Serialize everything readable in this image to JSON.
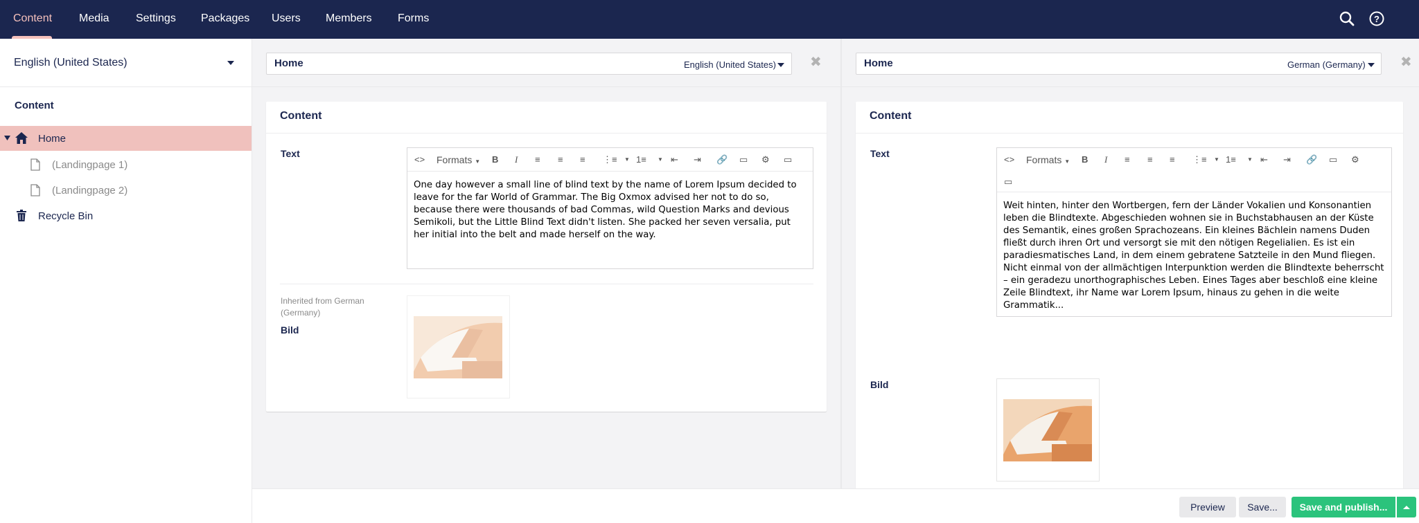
{
  "topnav": {
    "items": [
      {
        "label": "Content"
      },
      {
        "label": "Media"
      },
      {
        "label": "Settings"
      },
      {
        "label": "Packages"
      },
      {
        "label": "Users"
      },
      {
        "label": "Members"
      },
      {
        "label": "Forms"
      }
    ],
    "active": "Content"
  },
  "sidebar": {
    "language": "English (United States)",
    "section_title": "Content",
    "tree": [
      {
        "label": "Home",
        "icon": "home-icon",
        "selected": true
      },
      {
        "label": "(Landingpage 1)",
        "icon": "document-icon"
      },
      {
        "label": "(Landingpage 2)",
        "icon": "document-icon"
      },
      {
        "label": "Recycle Bin",
        "icon": "trash-icon"
      }
    ]
  },
  "left_editor": {
    "name": "Home",
    "language": "English (United States)",
    "card_title": "Content",
    "text_label": "Text",
    "text_content": "One day however a small line of blind text by the name of Lorem Ipsum decided to leave for the far World of Grammar. The Big Oxmox advised her not to do so, because there were thousands of bad Commas, wild Question Marks and devious Semikoli, but the Little Blind Text didn't listen. She packed her seven versalia, put her initial into the belt and made herself on the way.",
    "inherited_note": "Inherited from German (Germany)",
    "image_label": "Bild"
  },
  "right_editor": {
    "name": "Home",
    "language": "German (Germany)",
    "card_title": "Content",
    "text_label": "Text",
    "text_content": "Weit hinten, hinter den Wortbergen, fern der Länder Vokalien und Konsonantien leben die Blindtexte. Abgeschieden wohnen sie in Buchstabhausen an der Küste des Semantik, eines großen Sprachozeans. Ein kleines Bächlein namens Duden fließt durch ihren Ort und versorgt sie mit den nötigen Regelialien. Es ist ein paradiesmatisches Land, in dem einem gebratene Satzteile in den Mund fliegen. Nicht einmal von der allmächtigen Interpunktion werden die Blindtexte beherrscht – ein geradezu unorthographisches Leben. Eines Tages aber beschloß eine kleine Zeile Blindtext, ihr Name war Lorem Ipsum, hinaus zu gehen in die weite Grammatik...",
    "image_label": "Bild"
  },
  "toolbar": {
    "formats_label": "Formats"
  },
  "footer": {
    "preview_label": "Preview",
    "save_label": "Save...",
    "publish_label": "Save and publish..."
  },
  "colors": {
    "topbar": "#1b264f",
    "accent": "#f5c1bc",
    "selected_bg": "#f0c1bd",
    "publish": "#2bc37c"
  }
}
